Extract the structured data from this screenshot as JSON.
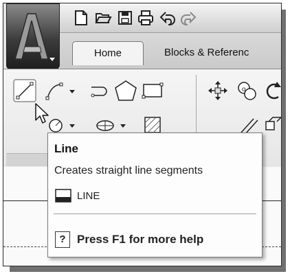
{
  "ribbon": {
    "tabs": [
      {
        "label": "Home",
        "active": true
      },
      {
        "label": "Blocks & Referenc",
        "active": false
      }
    ]
  },
  "icons": {
    "app_menu": "autocad-logo-icon",
    "quick_access": [
      "new-icon",
      "open-icon",
      "save-icon",
      "print-icon",
      "undo-icon",
      "redo-icon"
    ],
    "draw_panel": [
      "line-icon",
      "polyline-icon",
      "arc-icon",
      "polygon-icon",
      "rectangle-icon",
      "circle-icon",
      "ellipse-icon",
      "hatch-icon"
    ],
    "modify_panel": [
      "move-icon",
      "copy-icon",
      "rotate-icon",
      "offset-icon",
      "array-icon"
    ]
  },
  "tooltip": {
    "title": "Line",
    "description": "Creates straight line segments",
    "command": "LINE",
    "help": "Press F1 for more help",
    "help_glyph": "?"
  },
  "colors": {
    "ribbon_bg": "#ececec",
    "app_button": "#3c3c3c",
    "tooltip_bg": "#fdfdfd"
  }
}
